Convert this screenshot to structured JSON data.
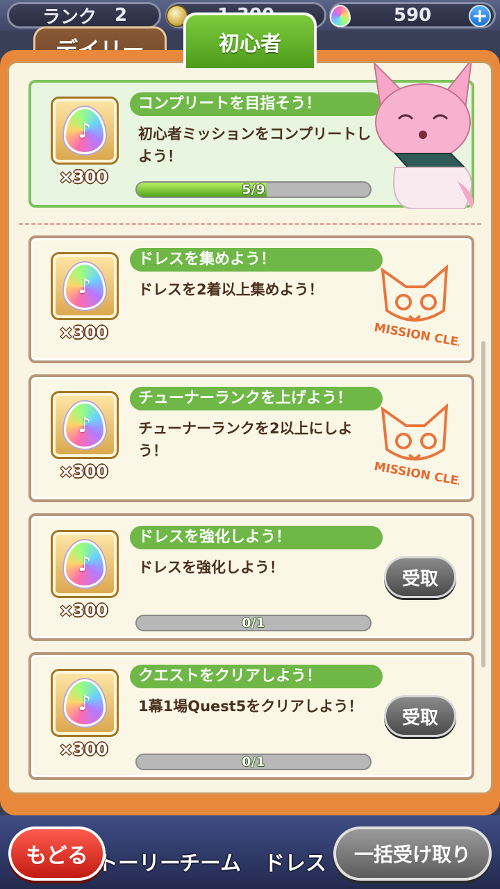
{
  "status": {
    "rank_label": "ランク",
    "rank_value": "2",
    "coins": "1,300",
    "gems": "590",
    "add_symbol": "+"
  },
  "tabs": [
    {
      "label": "デイリー",
      "active": false
    },
    {
      "label": "初心者",
      "active": true
    }
  ],
  "featured": {
    "title": "コンプリートを目指そう！",
    "description": "初心者ミッションをコンプリートしよう！",
    "reward_qty": "×300",
    "progress_text": "5/9",
    "progress_fraction": 0.556,
    "icon": "rainbow-gem-icon"
  },
  "missions": [
    {
      "title": "ドレスを集めよう！",
      "description": "ドレスを2着以上集めよう！",
      "reward_qty": "×300",
      "status": "cleared",
      "stamp_text": "MISSION CLEAR"
    },
    {
      "title": "チューナーランクを上げよう！",
      "description": "チューナーランクを2以上にしよう！",
      "reward_qty": "×300",
      "status": "cleared",
      "stamp_text": "MISSION CLEAR"
    },
    {
      "title": "ドレスを強化しよう！",
      "description": "ドレスを強化しよう！",
      "reward_qty": "×300",
      "status": "in-progress",
      "progress_text": "0/1",
      "progress_fraction": 0,
      "button_label": "受取"
    },
    {
      "title": "クエストをクリアしよう！",
      "description": "1幕1場Quest5をクリアしよう！",
      "reward_qty": "×300",
      "status": "in-progress",
      "progress_text": "0/1",
      "progress_fraction": 0,
      "button_label": "受取"
    }
  ],
  "bottom": {
    "back_label": "もどる",
    "nav_items": [
      "トーリー",
      "チーム",
      "ドレス"
    ],
    "claim_all_label": "一括受け取り"
  },
  "colors": {
    "panel_orange": "#e8883a",
    "title_green": "#6fb847",
    "back_red": "#d6281d"
  }
}
